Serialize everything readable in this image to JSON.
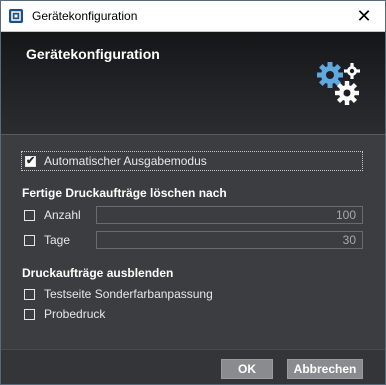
{
  "window": {
    "title": "Gerätekonfiguration",
    "close_glyph": "✕"
  },
  "header": {
    "title": "Gerätekonfiguration",
    "icon": "gears-icon"
  },
  "output": {
    "auto_mode_label": "Automatischer Ausgabemodus",
    "auto_mode_checked": true
  },
  "delete_section": {
    "title": "Fertige Druckaufträge löschen nach",
    "count_label": "Anzahl",
    "count_checked": false,
    "count_value": "100",
    "days_label": "Tage",
    "days_checked": false,
    "days_value": "30"
  },
  "hide_section": {
    "title": "Druckaufträge ausblenden",
    "spot_test_label": "Testseite Sonderfarbanpassung",
    "spot_test_checked": false,
    "proof_label": "Probedruck",
    "proof_checked": false
  },
  "buttons": {
    "ok": "OK",
    "cancel": "Abbrechen"
  },
  "colors": {
    "background": "#3c3d40",
    "header": "#1e1f22",
    "button": "#8a8b8e"
  }
}
